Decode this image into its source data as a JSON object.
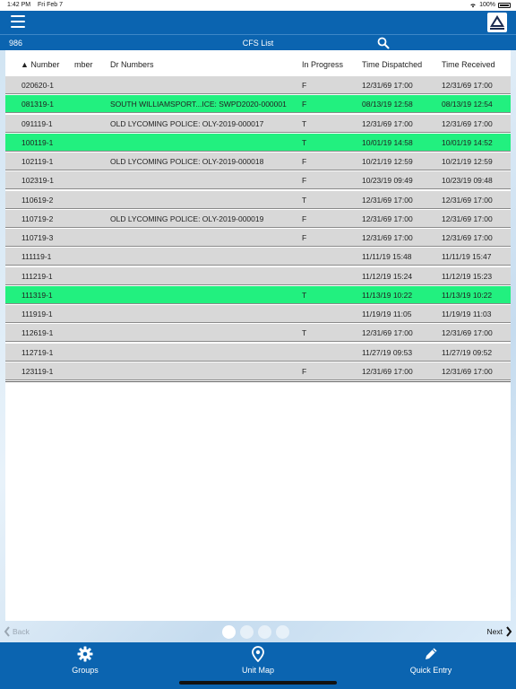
{
  "status": {
    "time": "1:42 PM",
    "date": "Fri Feb 7",
    "battery": "100%"
  },
  "header": {
    "unit_id": "986",
    "title": "CFS List"
  },
  "table": {
    "columns": {
      "number": "▲ Number",
      "member": "mber",
      "dr_numbers": "Dr Numbers",
      "in_progress": "In Progress",
      "time_dispatched": "Time Dispatched",
      "time_received": "Time Received"
    },
    "rows": [
      {
        "number": "020620-1",
        "dr": "",
        "progress": "F",
        "dispatched": "12/31/69 17:00",
        "received": "12/31/69 17:00",
        "highlight": "gray"
      },
      {
        "number": "081319-1",
        "dr": "SOUTH WILLIAMSPORT...ICE: SWPD2020-000001",
        "progress": "F",
        "dispatched": "08/13/19 12:58",
        "received": "08/13/19 12:54",
        "highlight": "green"
      },
      {
        "number": "091119-1",
        "dr": "OLD LYCOMING POLICE: OLY-2019-000017",
        "progress": "T",
        "dispatched": "12/31/69 17:00",
        "received": "12/31/69 17:00",
        "highlight": "gray"
      },
      {
        "number": "100119-1",
        "dr": "",
        "progress": "T",
        "dispatched": "10/01/19 14:58",
        "received": "10/01/19 14:52",
        "highlight": "green"
      },
      {
        "number": "102119-1",
        "dr": "OLD LYCOMING POLICE: OLY-2019-000018",
        "progress": "F",
        "dispatched": "10/21/19 12:59",
        "received": "10/21/19 12:59",
        "highlight": "gray"
      },
      {
        "number": "102319-1",
        "dr": "",
        "progress": "F",
        "dispatched": "10/23/19 09:49",
        "received": "10/23/19 09:48",
        "highlight": "gray"
      },
      {
        "number": "110619-2",
        "dr": "",
        "progress": "T",
        "dispatched": "12/31/69 17:00",
        "received": "12/31/69 17:00",
        "highlight": "gray"
      },
      {
        "number": "110719-2",
        "dr": "OLD LYCOMING POLICE: OLY-2019-000019",
        "progress": "F",
        "dispatched": "12/31/69 17:00",
        "received": "12/31/69 17:00",
        "highlight": "gray"
      },
      {
        "number": "110719-3",
        "dr": "",
        "progress": "F",
        "dispatched": "12/31/69 17:00",
        "received": "12/31/69 17:00",
        "highlight": "gray"
      },
      {
        "number": "111119-1",
        "dr": "",
        "progress": "",
        "dispatched": "11/11/19 15:48",
        "received": "11/11/19 15:47",
        "highlight": "gray"
      },
      {
        "number": "111219-1",
        "dr": "",
        "progress": "",
        "dispatched": "11/12/19 15:24",
        "received": "11/12/19 15:23",
        "highlight": "gray"
      },
      {
        "number": "111319-1",
        "dr": "",
        "progress": "T",
        "dispatched": "11/13/19 10:22",
        "received": "11/13/19 10:22",
        "highlight": "green"
      },
      {
        "number": "111919-1",
        "dr": "",
        "progress": "",
        "dispatched": "11/19/19 11:05",
        "received": "11/19/19 11:03",
        "highlight": "gray"
      },
      {
        "number": "112619-1",
        "dr": "",
        "progress": "T",
        "dispatched": "12/31/69 17:00",
        "received": "12/31/69 17:00",
        "highlight": "gray"
      },
      {
        "number": "112719-1",
        "dr": "",
        "progress": "",
        "dispatched": "11/27/19 09:53",
        "received": "11/27/19 09:52",
        "highlight": "gray"
      },
      {
        "number": "123119-1",
        "dr": "",
        "progress": "F",
        "dispatched": "12/31/69 17:00",
        "received": "12/31/69 17:00",
        "highlight": "gray"
      }
    ]
  },
  "pager": {
    "back_label": "Back",
    "next_label": "Next",
    "page_count": 4,
    "active_page": 1
  },
  "tabs": [
    {
      "label": "Groups",
      "icon": "gear-icon"
    },
    {
      "label": "Unit Map",
      "icon": "map-pin-icon"
    },
    {
      "label": "Quick Entry",
      "icon": "pencil-icon"
    }
  ],
  "colors": {
    "primary": "#0b64b0",
    "row_gray": "#d8d8d8",
    "row_green": "#22f07f"
  }
}
